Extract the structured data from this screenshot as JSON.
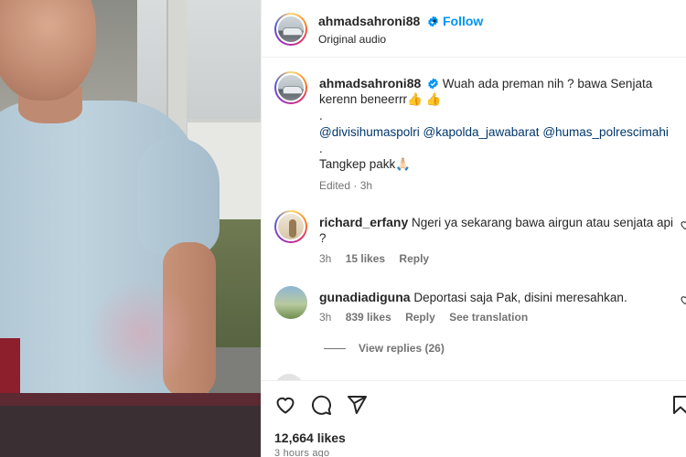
{
  "post": {
    "username": "ahmadsahroni88",
    "dot": "•",
    "follow_label": "Follow",
    "audio": "Original audio"
  },
  "caption": {
    "username": "ahmadsahroni88",
    "line1": "Wuah ada preman nih ? bawa Senjata",
    "line2": "kerenn beneerrr👍 👍",
    "line3": ".",
    "mention1": "@divisihumaspolri",
    "mention2": "@kapolda_jawabarat",
    "mention3": "@humas_polrescimahi",
    "line5": ".",
    "line6": "Tangkep pakk🙏🏻",
    "meta": "Edited · 3h"
  },
  "comments": [
    {
      "username": "richard_erfany",
      "text1": "Ngeri ya sekarang bawa airgun atau senjata api",
      "text2": "?",
      "time": "3h",
      "likes": "15 likes",
      "reply": "Reply"
    },
    {
      "username": "gunadiadiguna",
      "text1": "Deportasi saja Pak, disini meresahkan.",
      "time": "3h",
      "likes": "839 likes",
      "reply": "Reply",
      "translate": "See translation",
      "view_replies": "View replies (26)"
    }
  ],
  "actions": {
    "likes": "12,664 likes",
    "time": "3 hours ago"
  },
  "colors": {
    "link": "#0095f6",
    "mention": "#00376b",
    "secondary_text": "#737373",
    "primary_text": "#262626"
  },
  "icons": [
    "verified-badge-icon",
    "heart-icon",
    "comment-icon",
    "share-icon",
    "bookmark-icon"
  ]
}
